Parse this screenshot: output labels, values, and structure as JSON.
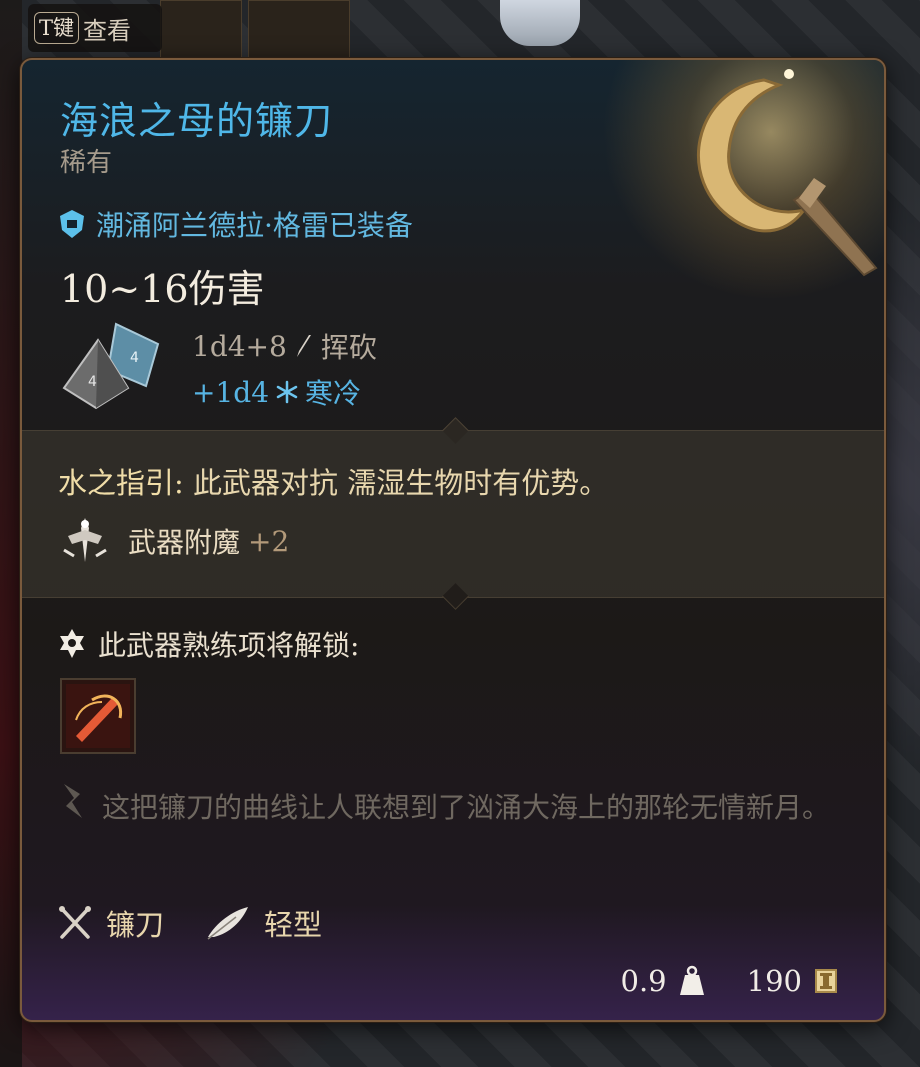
{
  "hud": {
    "key": "T键",
    "action": "查看"
  },
  "item": {
    "name": "海浪之母的镰刀",
    "rarity": "稀有",
    "equipped_by": "潮涌阿兰德拉·格雷已装备",
    "damage_total": "10~16伤害",
    "damage_lines": [
      {
        "dice": "1d4+8",
        "type": "挥砍",
        "icon": "slashing-icon"
      },
      {
        "dice": "+1d4",
        "type": "寒冷",
        "icon": "cold-icon"
      }
    ],
    "passive": {
      "name": "水之指引:",
      "text": "此武器对抗 濡湿生物时有优势。"
    },
    "enchantment": {
      "label": "武器附魔",
      "bonus": "+2"
    },
    "proficiency_label": "此武器熟练项将解锁:",
    "lore": "这把镰刀的曲线让人联想到了汹涌大海上的那轮无情新月。",
    "tags": [
      {
        "label": "镰刀",
        "icon": "sickle-icon"
      },
      {
        "label": "轻型",
        "icon": "feather-icon"
      }
    ],
    "weight": "0.9",
    "price": "190"
  },
  "colors": {
    "title": "#4fb7e8",
    "equipped": "#62b8e0",
    "cold": "#57b4e3",
    "gold_text": "#e8d6ad",
    "lore": "#6f6860"
  }
}
